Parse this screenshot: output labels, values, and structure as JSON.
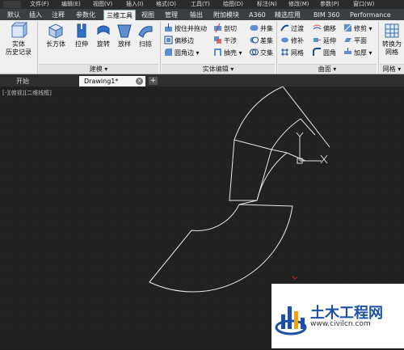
{
  "menubar": {
    "items": [
      "文件(F)",
      "编辑(E)",
      "视图(V)",
      "插入(I)",
      "格式(O)",
      "工具(T)",
      "绘图(D)",
      "标注(N)",
      "修改(M)",
      "参数(P)",
      "窗口(W)"
    ]
  },
  "ribbon_tabs": [
    "默认",
    "插入",
    "注释",
    "参数化",
    "三维工具",
    "视图",
    "管理",
    "输出",
    "附加模块",
    "A360",
    "精选应用",
    "BIM 360",
    "Performance"
  ],
  "ribbon_active_tab": "三维工具",
  "ribbon": {
    "history_label": "实体\n历史记录",
    "box_label": "长方体",
    "extrude_label": "拉伸",
    "revolve_label": "旋转",
    "loft_label": "放样",
    "sweep_label": "扫掠",
    "modeling_panel": "建模",
    "presspull": "按住并拖动",
    "offset_edge": "偏移边",
    "fillet_edge": "圆角边",
    "slice": "剖切",
    "interfere": "干涉",
    "shell": "抽壳",
    "union": "并集",
    "subtract": "差集",
    "intersect": "交集",
    "solid_edit_panel": "实体编辑",
    "blend": "过渡",
    "patch": "修补",
    "network": "网格",
    "surf_offset": "偏移",
    "extend": "延伸",
    "surf_fillet": "圆角",
    "trim": "修剪",
    "planar": "平面",
    "thicken": "加厚",
    "surface_panel": "曲面",
    "convert_mesh": "转换为\n网格",
    "mesh_panel": "网格"
  },
  "file_tabs": {
    "start": "开始",
    "drawing": "Drawing1*",
    "plus": "+"
  },
  "viewport_label": "[-][俯视][二维线框]",
  "watermark": {
    "title": "土木工程网",
    "url": "www.civilcn.com"
  },
  "colors": {
    "ribbon_bg": "#f0f0f0",
    "canvas_bg": "#212121",
    "line": "#ffffff",
    "grid": "#2f2f2f",
    "brand_blue": "#1c4fa8"
  }
}
